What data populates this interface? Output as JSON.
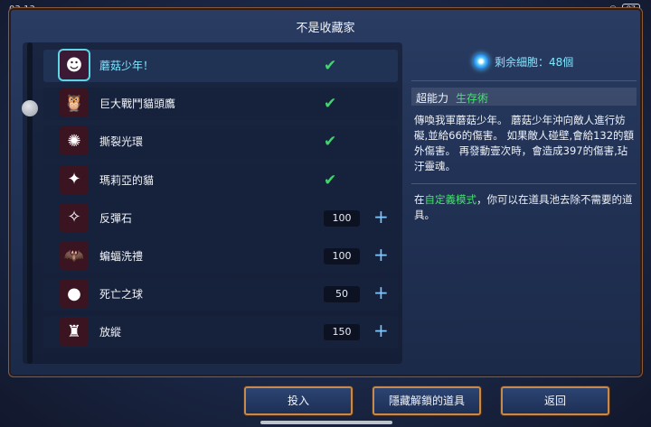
{
  "status": {
    "time": "03:13",
    "battery": "97"
  },
  "title": "不是收藏家",
  "items": [
    {
      "name": "蘑菇少年！",
      "owned": true,
      "selected": true,
      "icon": "mushroom-boy-icon",
      "glyph": "☻"
    },
    {
      "name": "巨大戰鬥貓頭鷹",
      "owned": true,
      "icon": "owl-icon",
      "glyph": "🦉"
    },
    {
      "name": "撕裂光環",
      "owned": true,
      "icon": "halo-icon",
      "glyph": "✺"
    },
    {
      "name": "瑪莉亞的貓",
      "owned": true,
      "icon": "cat-icon",
      "glyph": "✦"
    },
    {
      "name": "反彈石",
      "price": "100",
      "icon": "stone-icon",
      "glyph": "✧"
    },
    {
      "name": "蝙蝠洗禮",
      "price": "100",
      "icon": "bat-icon",
      "glyph": "🦇"
    },
    {
      "name": "死亡之球",
      "price": "50",
      "icon": "death-ball-icon",
      "glyph": "●"
    },
    {
      "name": "放縱",
      "price": "150",
      "icon": "indulgence-icon",
      "glyph": "♜"
    }
  ],
  "cells": {
    "text": "剩余細胞：48個",
    "icon": "cell-icon"
  },
  "power": {
    "label": "超能力",
    "name": "生存術",
    "description": "傳喚我軍蘑菇少年。 蘑菇少年沖向敵人進行妨礙,並給66的傷害。 如果敵人碰壁,會給132的額外傷害。 再發動壹次時，會造成397的傷害,玷汙靈魂。",
    "tip_before": "在",
    "tip_highlight": "自定義模式",
    "tip_after": "，你可以在道具池去除不需要的道具。"
  },
  "buttons": {
    "invest": "投入",
    "hide_unlocked": "隱藏解鎖的道具",
    "back": "返回"
  },
  "colors": {
    "accent": "#7fe6ff",
    "green": "#48e070",
    "border": "#c88a4a"
  }
}
